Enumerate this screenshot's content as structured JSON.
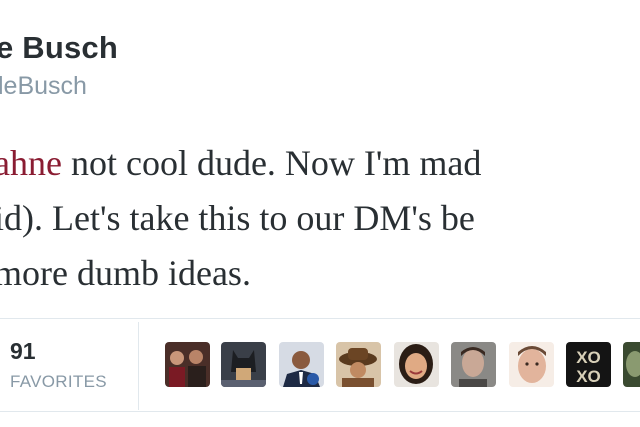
{
  "profile": {
    "name": "e Busch",
    "handle": "leBusch"
  },
  "tweet": {
    "mention": "ahne",
    "line1_rest": " not cool dude. Now I'm mad",
    "line2": "id). Let's take this to our DM's be",
    "line3": "more dumb ideas."
  },
  "stats": {
    "favorites_count": "91",
    "favorites_label": "FAVORITES"
  },
  "favoriters": [
    {
      "name": "group-photo-avatar",
      "colors": [
        "#3a2a24",
        "#8b1e2a"
      ]
    },
    {
      "name": "batman-avatar",
      "colors": [
        "#2a2d33",
        "#c9a15a"
      ]
    },
    {
      "name": "politician-avatar",
      "colors": [
        "#1f3a66",
        "#b58a6a"
      ]
    },
    {
      "name": "cowboy-hat-avatar",
      "colors": [
        "#5a3a1e",
        "#c49a6c"
      ]
    },
    {
      "name": "smiling-woman-avatar",
      "colors": [
        "#2b1d15",
        "#d9a27e"
      ]
    },
    {
      "name": "man-portrait-avatar",
      "colors": [
        "#6b6a68",
        "#c3a490"
      ]
    },
    {
      "name": "face-closeup-avatar",
      "colors": [
        "#f1e3d8",
        "#d8a48c"
      ]
    },
    {
      "name": "xoxo-avatar",
      "colors": [
        "#111111",
        "#d8d0b8"
      ]
    },
    {
      "name": "partial-avatar",
      "colors": [
        "#2a3a24",
        "#7a8a6a"
      ]
    }
  ]
}
